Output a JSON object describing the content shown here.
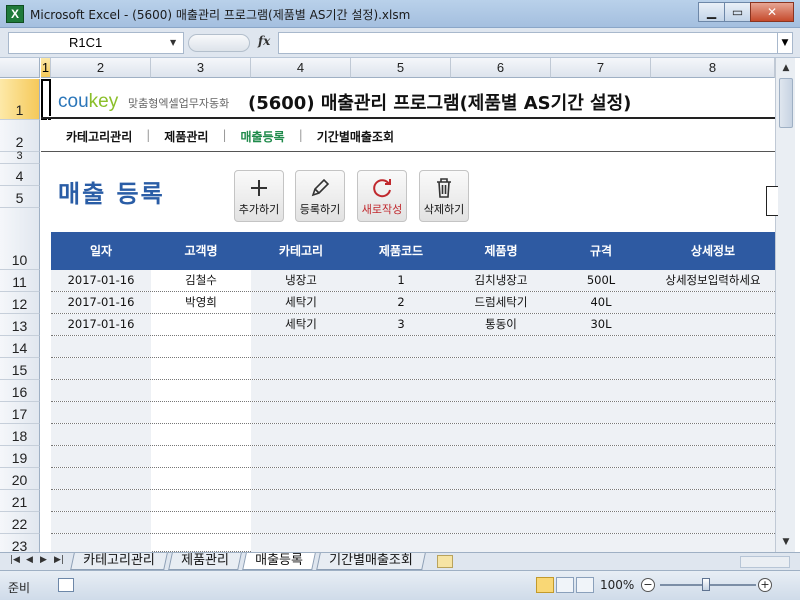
{
  "window": {
    "app_icon": "X",
    "title": "Microsoft Excel - (5600) 매출관리 프로그램(제품별 AS기간 설정).xlsm",
    "minimize": "▁",
    "maximize": "▭",
    "close": "✕"
  },
  "formula_bar": {
    "name_box": "R1C1",
    "fx": "fx",
    "formula": ""
  },
  "columns": [
    {
      "label": "1",
      "active": true
    },
    {
      "label": "2"
    },
    {
      "label": "3"
    },
    {
      "label": "4"
    },
    {
      "label": "5"
    },
    {
      "label": "6"
    },
    {
      "label": "7"
    },
    {
      "label": "8"
    }
  ],
  "rows": [
    "1",
    "2",
    "3",
    "4",
    "5",
    "10",
    "11",
    "12",
    "13",
    "14",
    "15",
    "16",
    "17",
    "18",
    "19",
    "20",
    "21",
    "22",
    "23"
  ],
  "sheet": {
    "logo_brand_a": "cou",
    "logo_brand_b": "key",
    "logo_sub": "맞춤형엑셀업무자동화",
    "title": "(5600) 매출관리 프로그램(제품별 AS기간 설정)",
    "nav": {
      "item1": "카테고리관리",
      "item2": "제품관리",
      "item3": "매출등록",
      "item4": "기간별매출조회",
      "separator": "|"
    },
    "heading": "매출 등록",
    "buttons": {
      "add": "추가하기",
      "register": "등록하기",
      "new_write": "새로작성",
      "delete": "삭제하기"
    }
  },
  "table": {
    "headers": [
      "일자",
      "고객명",
      "카테고리",
      "제품코드",
      "제품명",
      "규격",
      "상세정보"
    ],
    "rows": [
      [
        "2017-01-16",
        "김철수",
        "냉장고",
        "1",
        "김치냉장고",
        "500L",
        "상세정보입력하세요"
      ],
      [
        "2017-01-16",
        "박영희",
        "세탁기",
        "2",
        "드럼세탁기",
        "40L",
        ""
      ],
      [
        "2017-01-16",
        "",
        "세탁기",
        "3",
        "통동이",
        "30L",
        ""
      ]
    ],
    "header_color": "#2e5aa2"
  },
  "sheet_tabs": [
    "카테고리관리",
    "제품관리",
    "매출등록",
    "기간별매출조회"
  ],
  "active_tab": "매출등록",
  "status": {
    "ready": "준비",
    "zoom": "100%",
    "zoom_minus": "−",
    "zoom_plus": "+"
  }
}
